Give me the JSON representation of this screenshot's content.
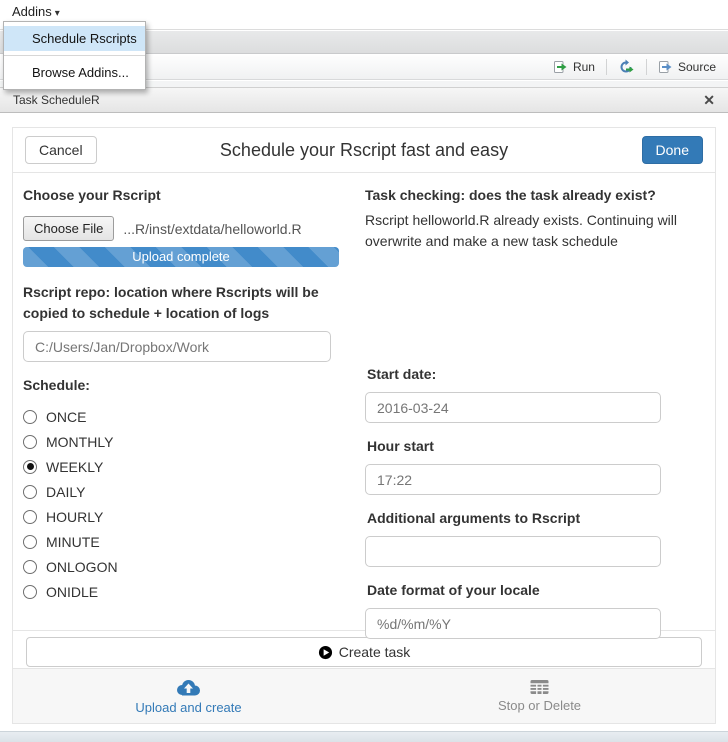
{
  "colors": {
    "accent_blue": "#337ab7",
    "progress_blue": "#428bca",
    "menu_highlight": "#cfe6f8",
    "inactive_gray": "#8a8a8a"
  },
  "rstudio": {
    "addins_menu_label": "Addins",
    "caret_glyph": "▾",
    "dropdown_items": [
      {
        "label": "Schedule Rscripts",
        "highlighted": true
      },
      {
        "label": "Browse Addins...",
        "highlighted": false
      }
    ],
    "toolbar": {
      "run_label": "Run",
      "source_label": "Source"
    }
  },
  "panel": {
    "title": "Task ScheduleR",
    "close_glyph": "✕"
  },
  "gadget": {
    "cancel_label": "Cancel",
    "title": "Schedule your Rscript fast and easy",
    "done_label": "Done",
    "left": {
      "choose_heading": "Choose your Rscript",
      "choose_file_label": "Choose File",
      "file_name": "...R/inst/extdata/helloworld.R",
      "upload_status": "Upload complete",
      "repo_heading": "Rscript repo: location where Rscripts will be copied to schedule + location of logs",
      "repo_value": "C:/Users/Jan/Dropbox/Work",
      "schedule_heading": "Schedule:",
      "schedule_options": [
        {
          "label": "ONCE",
          "selected": false
        },
        {
          "label": "MONTHLY",
          "selected": false
        },
        {
          "label": "WEEKLY",
          "selected": true
        },
        {
          "label": "DAILY",
          "selected": false
        },
        {
          "label": "HOURLY",
          "selected": false
        },
        {
          "label": "MINUTE",
          "selected": false
        },
        {
          "label": "ONLOGON",
          "selected": false
        },
        {
          "label": "ONIDLE",
          "selected": false
        }
      ]
    },
    "right": {
      "task_check_heading": "Task checking: does the task already exist?",
      "task_check_text": "Rscript helloworld.R already exists. Continuing will overwrite and make a new task schedule",
      "fields": [
        {
          "label": "Start date:",
          "value": "2016-03-24"
        },
        {
          "label": "Hour start",
          "value": "17:22"
        },
        {
          "label": "Additional arguments to Rscript",
          "value": ""
        },
        {
          "label": "Date format of your locale",
          "value": "%d/%m/%Y"
        }
      ]
    },
    "create_button_label": "Create task",
    "footer_tabs": [
      {
        "label": "Upload and create",
        "icon": "cloud-upload-icon",
        "active": true
      },
      {
        "label": "Stop or Delete",
        "icon": "table-icon",
        "active": false
      }
    ]
  }
}
